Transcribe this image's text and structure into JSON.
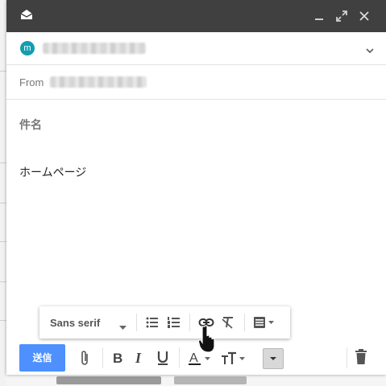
{
  "compose": {
    "from_label": "From",
    "subject_placeholder": "件名",
    "body_text": "ホームページ",
    "recipient_avatar_letter": "m"
  },
  "formatting": {
    "font_family": "Sans serif"
  },
  "actions": {
    "send_label": "送信"
  },
  "colors": {
    "titlebar": "#404040",
    "send_button": "#4d90fe",
    "avatar": "#129eaf"
  },
  "icons": [
    "envelope-icon",
    "minimize-icon",
    "expand-icon",
    "close-icon",
    "chevron-down-icon",
    "bulleted-list-icon",
    "numbered-list-icon",
    "link-icon",
    "remove-formatting-icon",
    "align-icon",
    "attach-icon",
    "bold-icon",
    "italic-icon",
    "underline-icon",
    "text-color-icon",
    "text-size-icon",
    "more-options-icon",
    "trash-icon",
    "hand-cursor-icon"
  ]
}
